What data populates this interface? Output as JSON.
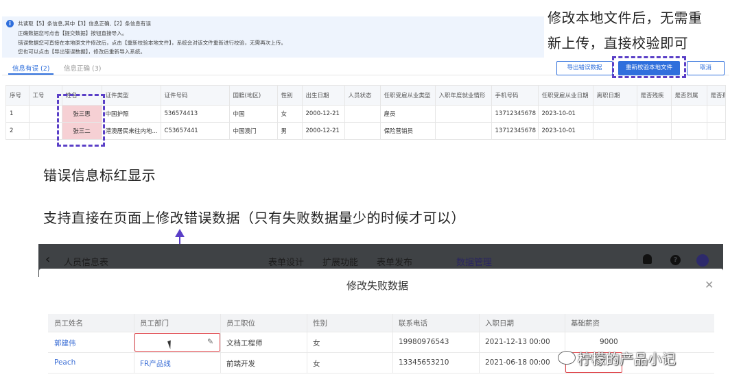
{
  "info": {
    "line1": "共读取【5】条信息,其中【3】信息正确,【2】条信息有误",
    "line2": "正确数据您可点击【提交数据】按钮直接导入。",
    "line3": "错误数据您可直接在本地原文件修改后，点击【重新校验本地文件】，系统会对该文件重新进行校验，无需再次上传。",
    "line4": "您也可以点击【导出错误数据】，修改后重新导入系统。"
  },
  "callout_top": {
    "line1": "修改本地文件后，无需重",
    "line2": "新上传，直接校验即可"
  },
  "tabs": [
    {
      "label": "信息有误 (2)"
    },
    {
      "label": "信息正确 (3)"
    }
  ],
  "buttons": {
    "export": "导出错误数据",
    "reverify": "重新校验本地文件",
    "cancel": "取消"
  },
  "grid": {
    "headers": [
      "序号",
      "工号",
      "姓名",
      "证件类型",
      "证件号码",
      "国籍(地区)",
      "性别",
      "出生日期",
      "人员状态",
      "任职受雇从业类型",
      "入职年度就业情形",
      "手机号码",
      "任职受雇从业日期",
      "离职日期",
      "是否残疾",
      "是否烈属",
      "是否孤"
    ],
    "rows": [
      [
        "1",
        "",
        "张三思",
        "中国护照",
        "536574413",
        "中国",
        "女",
        "2000-12-21",
        "",
        "雇员",
        "",
        "13712345678",
        "2023-10-01",
        "",
        "",
        "",
        ""
      ],
      [
        "2",
        "",
        "张三二",
        "港澳居民来往内地...",
        "C53657441",
        "中国澳门",
        "男",
        "2000-12-21",
        "",
        "保险营销员",
        "",
        "13712345678",
        "2023-10-01",
        "",
        "",
        "",
        ""
      ]
    ]
  },
  "annotations": {
    "red_mark": "错误信息标红显示",
    "edit_support": "支持直接在页面上修改错误数据（只有失败数据量少的时候才可以）"
  },
  "app": {
    "title": "人员信息表",
    "nav": [
      "表单设计",
      "扩展功能",
      "表单发布",
      "数据管理"
    ]
  },
  "modal": {
    "title": "修改失败数据",
    "headers": [
      "员工姓名",
      "员工部门",
      "员工职位",
      "性别",
      "联系电话",
      "入职日期",
      "基础薪资"
    ],
    "rows": [
      [
        "郭建伟",
        "",
        "文档工程师",
        "女",
        "19980976543",
        "2021-12-13 00:00",
        "9000"
      ],
      [
        "Peach",
        "FR产品线",
        "前端开发",
        "女",
        "13345653210",
        "2021-06-18 00:00",
        ""
      ]
    ]
  },
  "watermark": "柠檬的产品小记",
  "colors": {
    "accent": "#2f6fdc",
    "annotation": "#5a3fc7",
    "error": "#e0474c",
    "error_fill": "#f6d0d4"
  }
}
